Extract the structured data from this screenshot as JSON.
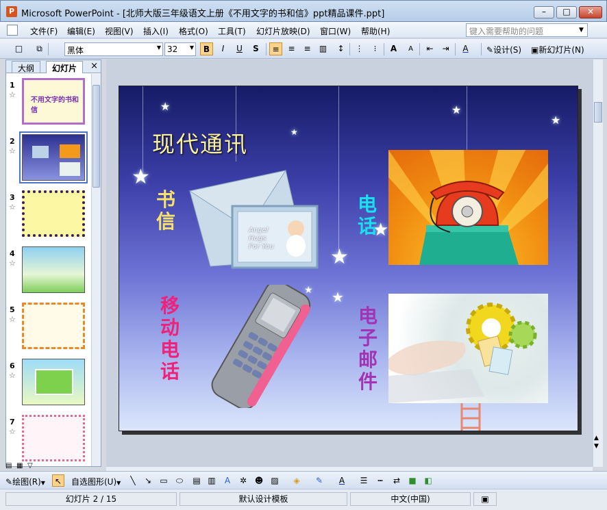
{
  "window": {
    "title": "Microsoft PowerPoint - [北师大版三年级语文上册《不用文字的书和信》ppt精品课件.ppt]",
    "app_icon": "powerpoint-icon",
    "minimize_label": "–",
    "maximize_label": "□",
    "close_label": "✕"
  },
  "menu": {
    "items": [
      "文件(F)",
      "编辑(E)",
      "视图(V)",
      "插入(I)",
      "格式(O)",
      "工具(T)",
      "幻灯片放映(D)",
      "窗口(W)",
      "帮助(H)"
    ],
    "help_placeholder": "键入需要帮助的问题"
  },
  "toolbar": {
    "font_name": "黑体",
    "font_size": "32",
    "bold": "B",
    "italic": "I",
    "underline": "U",
    "shadow": "S",
    "design_label": "设计(S)",
    "new_slide_label": "新幻灯片(N)"
  },
  "leftpane": {
    "tabs": [
      "大纲",
      "幻灯片"
    ],
    "close": "×",
    "selected_index": 1,
    "slides": [
      "1",
      "2",
      "3",
      "4",
      "5",
      "6",
      "7"
    ],
    "thumb1_text": "不用文字的书和信"
  },
  "slide": {
    "title": "现代通讯",
    "label_letter": [
      "书",
      "信"
    ],
    "label_phone": [
      "电",
      "话"
    ],
    "label_mobile": [
      "移",
      "动",
      "电",
      "话"
    ],
    "label_email": [
      "电",
      "子",
      "邮",
      "件"
    ],
    "letter_card_text": [
      "Angel",
      "Hugs",
      "For You"
    ],
    "colors": {
      "title": "#f7f0a0",
      "letter": "#f7e36a",
      "phone": "#19e0ef",
      "mobile": "#f0217a",
      "email": "#a133b4"
    }
  },
  "drawbar": {
    "draw_label": "绘图(R)",
    "autoshape_label": "自选图形(U)"
  },
  "status": {
    "slide_info": "幻灯片 2 / 15",
    "template": "默认设计模板",
    "language": "中文(中国)"
  }
}
